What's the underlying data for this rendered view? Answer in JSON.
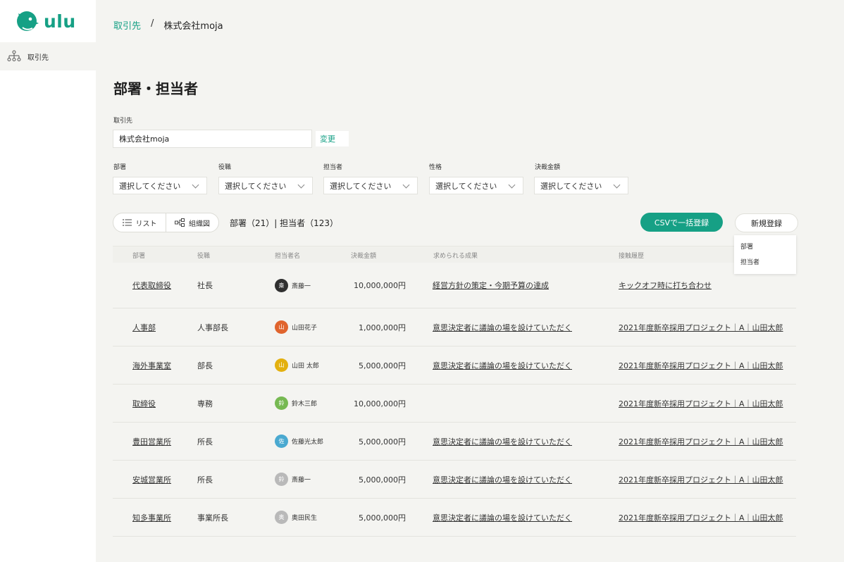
{
  "app": {
    "logo_text": "ulu",
    "brand_color": "#16a085"
  },
  "sidebar": {
    "items": [
      {
        "label": "取引先",
        "icon": "org-chart-icon"
      }
    ]
  },
  "breadcrumb": {
    "parent": "取引先",
    "separator": "/",
    "current": "株式会社moja"
  },
  "page": {
    "title": "部署・担当者"
  },
  "client": {
    "label": "取引先",
    "value": "株式会社moja",
    "change_label": "変更"
  },
  "filters": [
    {
      "label": "部署",
      "placeholder": "選択してください"
    },
    {
      "label": "役職",
      "placeholder": "選択してください"
    },
    {
      "label": "担当者",
      "placeholder": "選択してください"
    },
    {
      "label": "性格",
      "placeholder": "選択してください"
    },
    {
      "label": "決裁金額",
      "placeholder": "選択してください"
    }
  ],
  "view_toggle": {
    "list_label": "リスト",
    "org_label": "組織図"
  },
  "counts_text": "部署（21）| 担当者（123）",
  "actions": {
    "csv_label": "CSVで一括登録",
    "new_label": "新規登録",
    "new_menu": [
      "部署",
      "担当者"
    ]
  },
  "table": {
    "headers": [
      "部署",
      "役職",
      "担当者名",
      "決裁金額",
      "求められる成果",
      "接触履歴"
    ],
    "rows": [
      {
        "dept": "代表取締役",
        "role": "社長",
        "avatar_char": "斎",
        "avatar_color": "#2f2f2f",
        "person": "斎藤一",
        "amount": "10,000,000円",
        "outcome": "経営方針の策定・今期予算の達成",
        "history": "キックオフ時に打ち合わせ"
      },
      {
        "dept": "人事部",
        "role": "人事部長",
        "avatar_char": "山",
        "avatar_color": "#e0642d",
        "person": "山田花子",
        "amount": "1,000,000円",
        "outcome": "意思決定者に議論の場を設けていただく",
        "history": "2021年度新卒採用プロジェクト｜A｜山田太郎"
      },
      {
        "dept": "海外事業室",
        "role": "部長",
        "avatar_char": "山",
        "avatar_color": "#e3b00f",
        "person": "山田 太郎",
        "amount": "5,000,000円",
        "outcome": "意思決定者に議論の場を設けていただく",
        "history": "2021年度新卒採用プロジェクト｜A｜山田太郎"
      },
      {
        "dept": "取締役",
        "role": "専務",
        "avatar_char": "鈴",
        "avatar_color": "#76b952",
        "person": "鈴木三郎",
        "amount": "10,000,000円",
        "outcome": "",
        "history": "2021年度新卒採用プロジェクト｜A｜山田太郎"
      },
      {
        "dept": "豊田営業所",
        "role": "所長",
        "avatar_char": "佐",
        "avatar_color": "#4aa9d0",
        "person": "佐藤光太郎",
        "amount": "5,000,000円",
        "outcome": "意思決定者に議論の場を設けていただく",
        "history": "2021年度新卒採用プロジェクト｜A｜山田太郎"
      },
      {
        "dept": "安城営業所",
        "role": "所長",
        "avatar_char": "鈴",
        "avatar_color": "#b9b9b9",
        "person": "斎藤一",
        "amount": "5,000,000円",
        "outcome": "意思決定者に議論の場を設けていただく",
        "history": "2021年度新卒採用プロジェクト｜A｜山田太郎"
      },
      {
        "dept": "知多事業所",
        "role": "事業所長",
        "avatar_char": "奥",
        "avatar_color": "#b9b9b9",
        "person": "奥田民生",
        "amount": "5,000,000円",
        "outcome": "意思決定者に議論の場を設けていただく",
        "history": "2021年度新卒採用プロジェクト｜A｜山田太郎"
      }
    ]
  }
}
